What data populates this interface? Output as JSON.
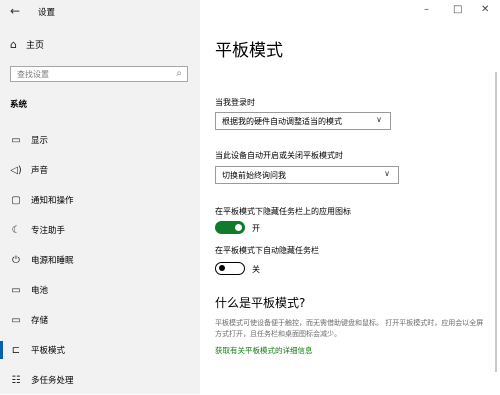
{
  "app": {
    "title": "设置",
    "back_icon": "back-arrow-icon"
  },
  "window": {
    "minimize": "–",
    "maximize": "□",
    "close": "✕"
  },
  "sidebar": {
    "home_label": "主页",
    "search_placeholder": "查找设置",
    "section": "系统",
    "items": [
      {
        "label": "显示",
        "icon": "display-icon",
        "glyph": "▭"
      },
      {
        "label": "声音",
        "icon": "sound-icon",
        "glyph": "🔈"
      },
      {
        "label": "通知和操作",
        "icon": "notification-icon",
        "glyph": "▢"
      },
      {
        "label": "专注助手",
        "icon": "moon-icon",
        "glyph": "☾"
      },
      {
        "label": "电源和睡眠",
        "icon": "power-icon",
        "glyph": "⏻"
      },
      {
        "label": "电池",
        "icon": "battery-icon",
        "glyph": "▭"
      },
      {
        "label": "存储",
        "icon": "storage-icon",
        "glyph": "▭"
      },
      {
        "label": "平板模式",
        "icon": "tablet-icon",
        "glyph": "⌐",
        "active": true
      },
      {
        "label": "多任务处理",
        "icon": "multitasking-icon",
        "glyph": "☷"
      }
    ]
  },
  "main": {
    "title": "平板模式",
    "signin_label": "当我登录时",
    "signin_value": "根据我的硬件自动调整适当的模式",
    "switch_label": "当此设备自动开启或关闭平板模式时",
    "switch_value": "切换前始终询问我",
    "hide_icons_label": "在平板模式下隐藏任务栏上的应用图标",
    "hide_icons_state": "开",
    "hide_icons_on": true,
    "autohide_label": "在平板模式下自动隐藏任务栏",
    "autohide_state": "关",
    "autohide_on": false,
    "what_title": "什么是平板模式?",
    "description": "平板模式可使设备便于触控，而无需借助键盘和鼠标。 打开平板模式时，应用会以全屏方式打开，且任务栏和桌面图标会减少。",
    "link": "获取有关平板模式的详细信息"
  }
}
